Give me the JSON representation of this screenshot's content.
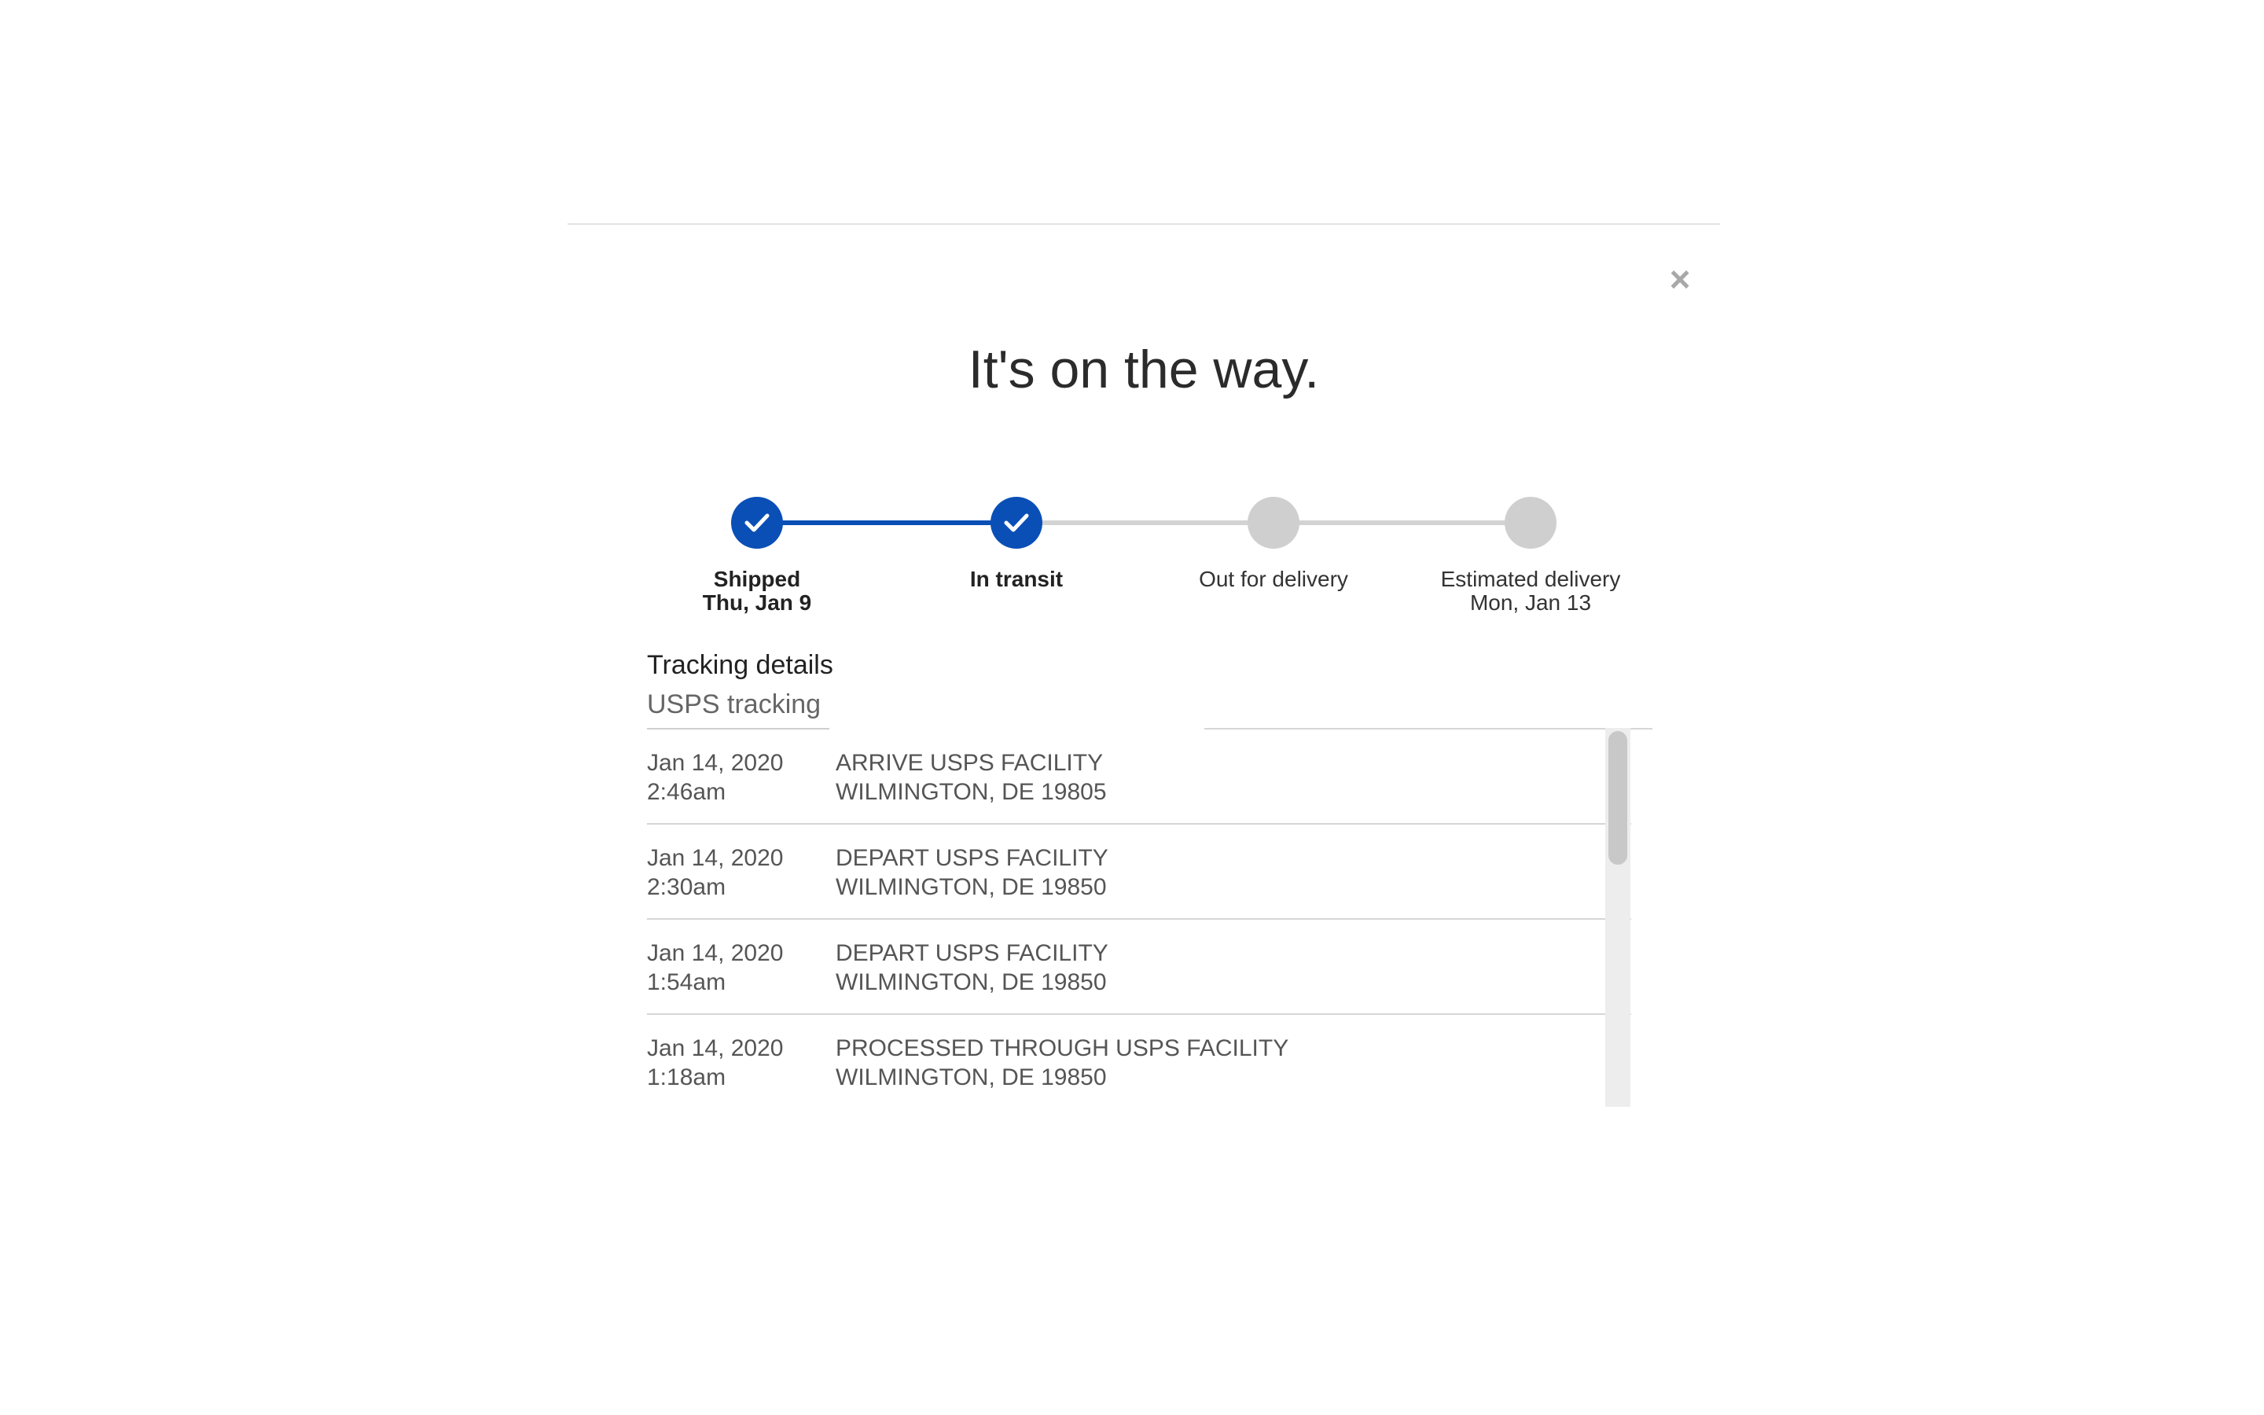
{
  "modal": {
    "close_symbol": "×",
    "title": "It's on the way."
  },
  "stepper": {
    "steps": [
      {
        "label": "Shipped",
        "sub": "Thu, Jan 9",
        "status": "done"
      },
      {
        "label": "In transit",
        "sub": "",
        "status": "done"
      },
      {
        "label": "Out for delivery",
        "sub": "",
        "status": "pending"
      },
      {
        "label": "Estimated delivery",
        "sub": "Mon, Jan 13",
        "status": "pending"
      }
    ]
  },
  "tracking": {
    "heading": "Tracking details",
    "carrier_label": "USPS tracking",
    "events": [
      {
        "date": "Jan 14, 2020",
        "time": "2:46am",
        "status": "ARRIVE USPS FACILITY",
        "location": "WILMINGTON, DE 19805"
      },
      {
        "date": "Jan 14, 2020",
        "time": "2:30am",
        "status": "DEPART USPS FACILITY",
        "location": "WILMINGTON, DE 19850"
      },
      {
        "date": "Jan 14, 2020",
        "time": "1:54am",
        "status": "DEPART USPS FACILITY",
        "location": "WILMINGTON, DE 19850"
      },
      {
        "date": "Jan 14, 2020",
        "time": "1:18am",
        "status": "PROCESSED THROUGH USPS FACILITY",
        "location": "WILMINGTON, DE 19850"
      }
    ]
  },
  "colors": {
    "accent": "#0a4fb6",
    "pending": "#cfcfcf",
    "divider": "#d6d6d6"
  }
}
